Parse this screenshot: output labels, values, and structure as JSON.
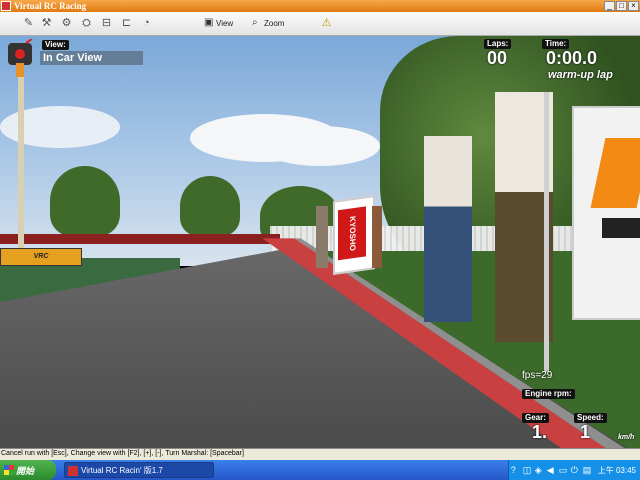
{
  "window": {
    "title": "Virtual RC Racing"
  },
  "toolbar": {
    "view_label": "View",
    "zoom_label": "Zoom"
  },
  "hud": {
    "view_label": "View:",
    "view_value": "In Car View",
    "laps_label": "Laps:",
    "laps_value": "00",
    "time_label": "Time:",
    "time_value": "0:00.0",
    "lap_status": "warm-up lap",
    "fps": "fps=29",
    "engine_rpm_label": "Engine rpm:",
    "gear_label": "Gear:",
    "gear_value": "1.",
    "speed_label": "Speed:",
    "speed_value": "1",
    "speed_unit": "km/h"
  },
  "scene": {
    "banner_text": "KYOSHO"
  },
  "statusbar": {
    "hint": "Cancel run with [Esc], Change view with [F2], [+], [-], Turn Marshal: [Spacebar]"
  },
  "taskbar": {
    "start_label": "開始",
    "task_label": "Virtual RC Racin' 版1.7",
    "clock": "上午 03:45"
  }
}
